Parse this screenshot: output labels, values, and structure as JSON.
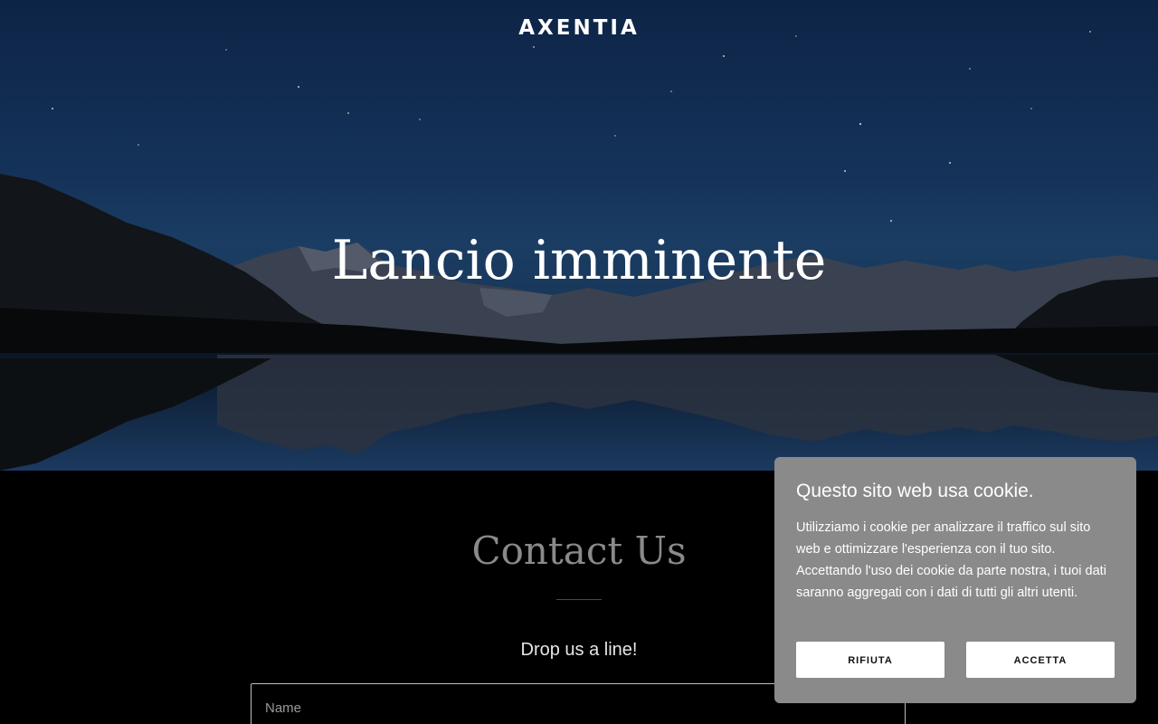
{
  "header": {
    "brand": "AXENTIA"
  },
  "hero": {
    "title": "Lancio imminente"
  },
  "contact": {
    "title": "Contact Us",
    "subtitle": "Drop us a line!",
    "name_placeholder": "Name"
  },
  "cookie_banner": {
    "title": "Questo sito web usa cookie.",
    "body": "Utilizziamo i cookie per analizzare il traffico sul sito web e ottimizzare l'esperienza con il tuo sito. Accettando l'uso dei cookie da parte nostra, i tuoi dati saranno aggregati con i dati di tutti gli altri utenti.",
    "reject_label": "RIFIUTA",
    "accept_label": "ACCETTA"
  },
  "colors": {
    "sky_top": "#0d2446",
    "contact_background": "#000000",
    "cookie_background": "#8a8a8a",
    "button_background": "#ffffff"
  }
}
